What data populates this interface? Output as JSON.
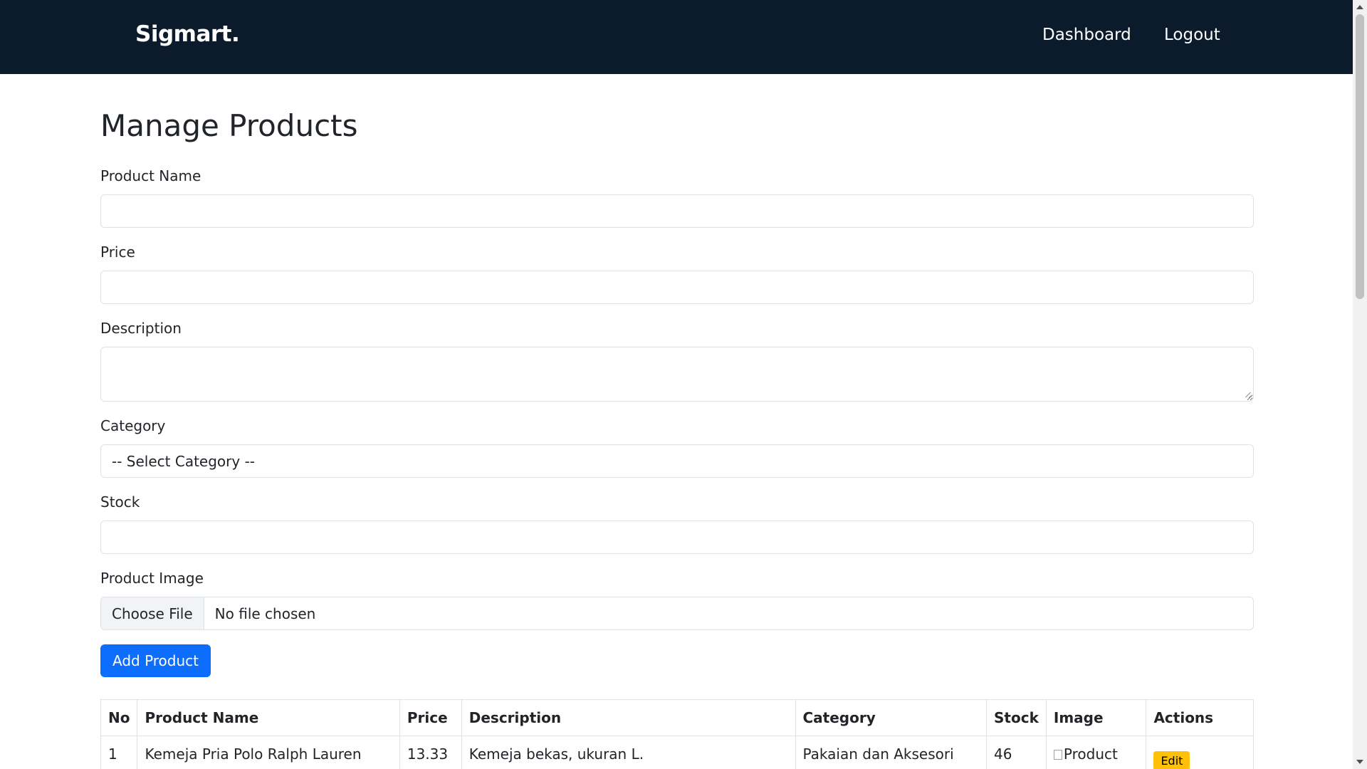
{
  "nav": {
    "brand": "Sigmart.",
    "links": [
      "Dashboard",
      "Logout"
    ]
  },
  "page": {
    "title": "Manage Products"
  },
  "form": {
    "product_name_label": "Product Name",
    "product_name_value": "",
    "price_label": "Price",
    "price_value": "",
    "description_label": "Description",
    "description_value": "",
    "category_label": "Category",
    "category_selected": "-- Select Category --",
    "stock_label": "Stock",
    "stock_value": "",
    "image_label": "Product Image",
    "file_button": "Choose File",
    "file_status": "No file chosen",
    "submit_label": "Add Product"
  },
  "table": {
    "headers": [
      "No",
      "Product Name",
      "Price",
      "Description",
      "Category",
      "Stock",
      "Image",
      "Actions"
    ],
    "rows": [
      {
        "no": "1",
        "name": "Kemeja Pria Polo Ralph Lauren",
        "price": "13.33",
        "description": "Kemeja bekas, ukuran L.",
        "category": "Pakaian dan Aksesori",
        "stock": "46",
        "image_alt": "Product",
        "action_edit": "Edit"
      }
    ]
  },
  "colors": {
    "navbar": "#0b1b2b",
    "primary": "#0d6efd",
    "warning": "#ffc107"
  }
}
